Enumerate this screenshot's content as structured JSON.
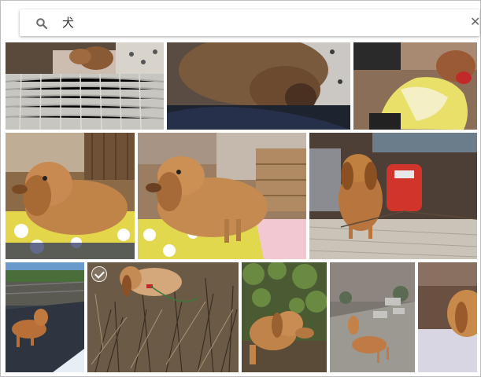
{
  "search": {
    "query": "犬",
    "icon": "search-icon",
    "clear_icon": "close-icon"
  },
  "results": {
    "photos": [
      {
        "subject": "dachshund-on-wicker-bed"
      },
      {
        "subject": "dachshund-closeup-dark"
      },
      {
        "subject": "dachshund-yellow-blanket"
      },
      {
        "subject": "dachshund-on-floral-cushion"
      },
      {
        "subject": "dachshund-on-floral-cushion-2"
      },
      {
        "subject": "dachshund-standing-red-bag"
      },
      {
        "subject": "dachshund-on-street"
      },
      {
        "subject": "dachshund-in-dry-grass",
        "selected_check": true
      },
      {
        "subject": "dachshund-in-garden"
      },
      {
        "subject": "dachshund-in-rubble"
      },
      {
        "subject": "dachshund-on-sofa"
      }
    ]
  },
  "colors": {
    "search_icon": "#6e6e6e",
    "divider": "#ffffff",
    "dog_fur": "#b5651d"
  }
}
